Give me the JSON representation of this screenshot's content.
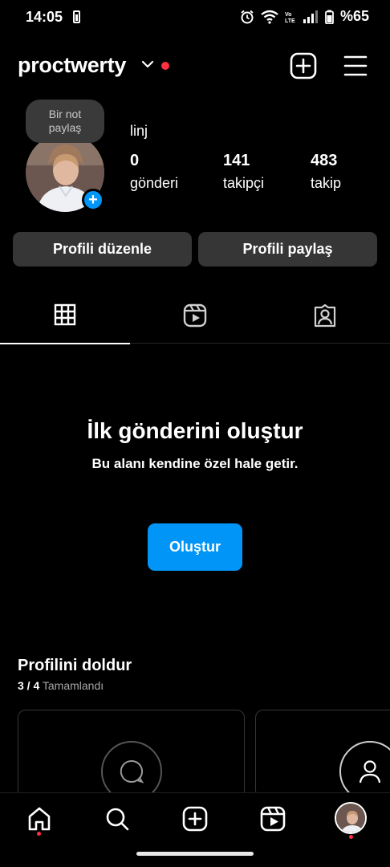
{
  "status_bar": {
    "time": "14:05",
    "battery_label": "%65",
    "icons": [
      "battery-small-icon",
      "alarm-icon",
      "wifi-icon",
      "volte-icon",
      "signal-icon",
      "battery-icon"
    ]
  },
  "header": {
    "username": "proctwerty",
    "icons": [
      "chevron-down-icon",
      "notification-dot",
      "create-plus-icon",
      "menu-icon"
    ]
  },
  "profile": {
    "note_line1": "Bir not",
    "note_line2": "paylaş",
    "name": "linj",
    "stats": [
      {
        "value": "0",
        "label": "gönderi"
      },
      {
        "value": "141",
        "label": "takipçi"
      },
      {
        "value": "483",
        "label": "takip"
      }
    ]
  },
  "actions": {
    "edit_profile": "Profili düzenle",
    "share_profile": "Profili paylaş"
  },
  "tabs": [
    {
      "name": "grid",
      "icon": "grid-icon",
      "active": true
    },
    {
      "name": "reels",
      "icon": "reels-icon",
      "active": false
    },
    {
      "name": "tagged",
      "icon": "tagged-icon",
      "active": false
    }
  ],
  "empty_state": {
    "title": "İlk gönderini oluştur",
    "subtitle": "Bu alanı kendine özel hale getir.",
    "button": "Oluştur"
  },
  "complete_profile": {
    "title": "Profilini doldur",
    "progress": "3 / 4",
    "progress_label": "Tamamlandı"
  },
  "bottom_nav": [
    "home-icon",
    "search-icon",
    "create-icon",
    "reels-icon",
    "profile-avatar"
  ],
  "colors": {
    "accent": "#0095f6",
    "background": "#000000",
    "button_bg": "#363636",
    "notification": "#ff3040"
  }
}
